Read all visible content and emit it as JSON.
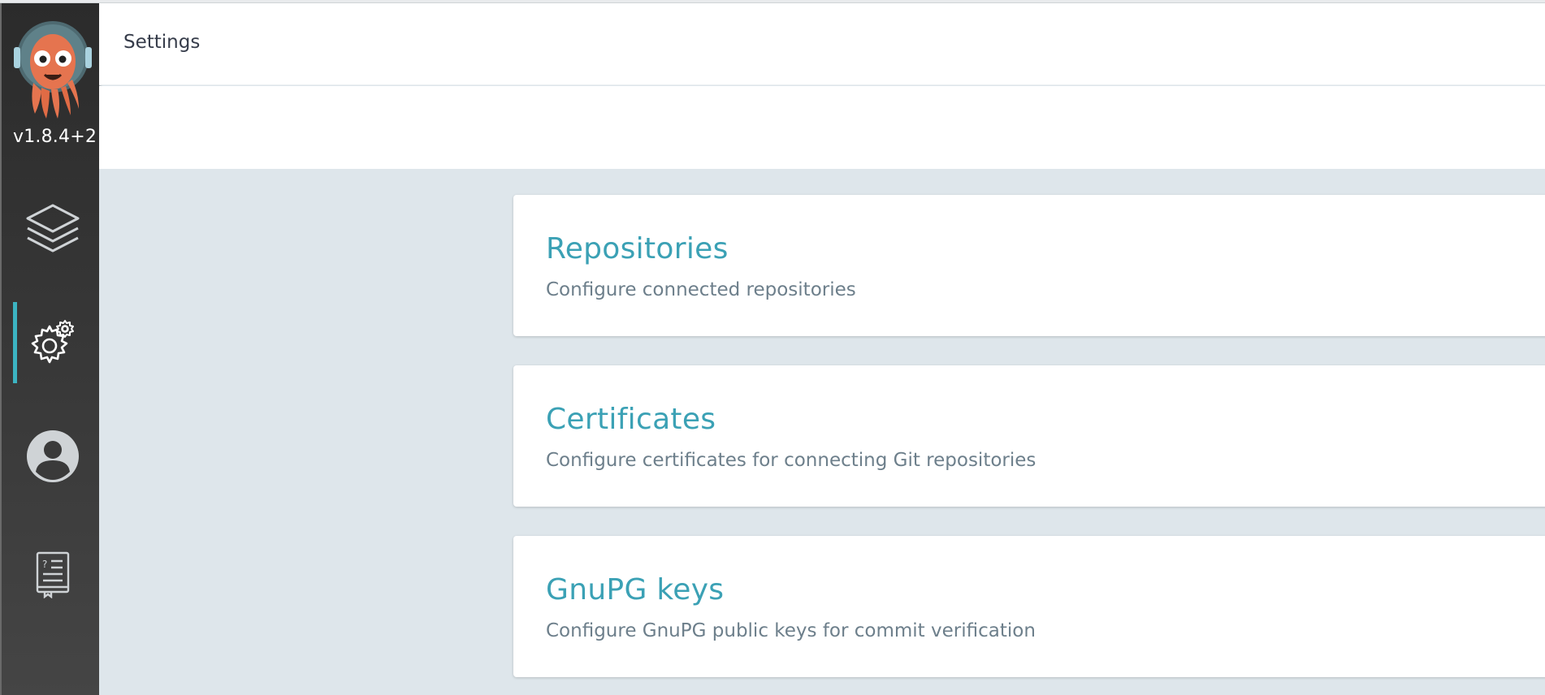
{
  "app": {
    "version": "v1.8.4+2",
    "logo_icon": "argo-octopus-logo"
  },
  "sidebar": {
    "items": [
      {
        "name": "applications",
        "icon": "layers-icon",
        "active": false
      },
      {
        "name": "settings",
        "icon": "gears-icon",
        "active": true
      },
      {
        "name": "user-info",
        "icon": "user-circle-icon",
        "active": false
      },
      {
        "name": "documentation",
        "icon": "book-icon",
        "active": false
      }
    ],
    "accent_color": "#3cb4c2"
  },
  "header": {
    "title": "Settings"
  },
  "settings": {
    "cards": [
      {
        "title": "Repositories",
        "description": "Configure connected repositories"
      },
      {
        "title": "Certificates",
        "description": "Configure certificates for connecting Git repositories"
      },
      {
        "title": "GnuPG keys",
        "description": "Configure GnuPG public keys for commit verification"
      }
    ]
  },
  "colors": {
    "card_title": "#3ba1b5",
    "background": "#dee6eb",
    "sidebar": "#2b2b2b"
  }
}
